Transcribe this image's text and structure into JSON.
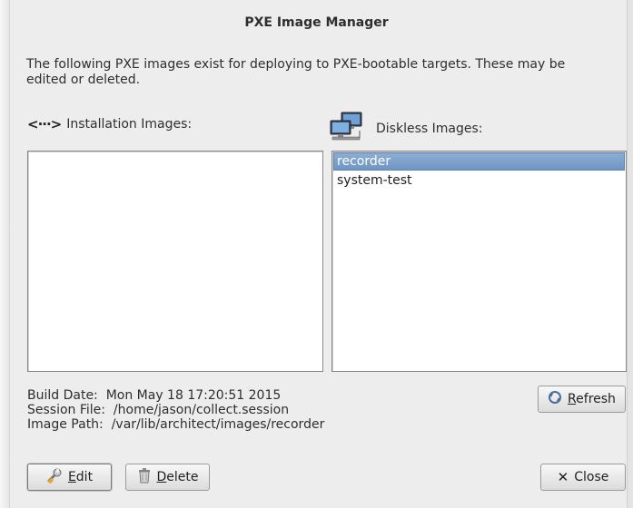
{
  "window": {
    "title": "PXE Image Manager"
  },
  "intro": "The following PXE images exist for deploying to PXE-bootable targets.  These may be edited or deleted.",
  "installation": {
    "icon": "network-arrows-icon",
    "label": "Installation Images:",
    "items": []
  },
  "diskless": {
    "icon": "networked-computers-icon",
    "label": "Diskless Images:",
    "items": [
      "recorder",
      "system-test"
    ],
    "selected": "recorder"
  },
  "info": {
    "build_date_label": "Build Date:",
    "build_date": "Mon May 18 17:20:51 2015",
    "session_file_label": "Session File:",
    "session_file": "/home/jason/collect.session",
    "image_path_label": "Image Path:",
    "image_path": "/var/lib/architect/images/recorder"
  },
  "buttons": {
    "refresh": {
      "mnemonic": "R",
      "rest": "efresh",
      "icon": "refresh-icon"
    },
    "edit": {
      "mnemonic": "E",
      "rest": "dit",
      "icon": "wrench-icon"
    },
    "delete": {
      "mnemonic": "D",
      "rest": "elete",
      "icon": "trash-icon"
    },
    "close": {
      "label": "Close",
      "icon": "close-x-icon"
    }
  }
}
